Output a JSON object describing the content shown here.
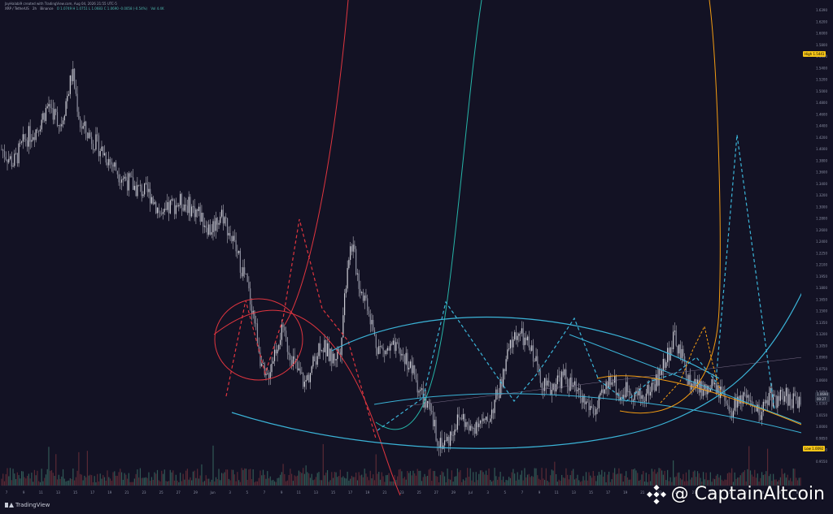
{
  "header": {
    "author": "JayHalabi9 created with TradingView.com, Aug 04, 2026 21:55 UTC-5",
    "symbol": "XRP / TetherUS",
    "interval": "2h",
    "exchange": "Binance",
    "ohlc": "O 1.0749  H 1.0751  L 1.0683  C 1.0690  -0.0058 (-0.54%)",
    "volume": "Vol 4.4K"
  },
  "badges": {
    "high_label": "High",
    "high_value": "1.5441",
    "low_label": "Low",
    "low_value": "1.0092",
    "price_value": "1.0690",
    "price_time": "00:27"
  },
  "branding": {
    "tradingview": "TradingView",
    "watermark": "@ CaptainAltcoin"
  },
  "colors": {
    "background": "#131224",
    "candle": "#d0d0d8",
    "volume_up": "#3a6b63",
    "volume_down": "#6b2f3a",
    "red_curve": "#e0353f",
    "teal_curve": "#26b5a8",
    "orange_curve": "#f39c12",
    "cyan_line": "#3bb4d8",
    "axis_text": "#8a8fa3"
  },
  "chart_data": {
    "type": "candlestick",
    "title": "",
    "xlabel": "",
    "ylabel": "",
    "ylim": [
      0.955,
      1.639
    ],
    "x_ticks": [
      "7",
      "9",
      "11",
      "13",
      "15",
      "17",
      "19",
      "21",
      "23",
      "25",
      "27",
      "29",
      "Jun",
      "3",
      "5",
      "7",
      "9",
      "11",
      "13",
      "15",
      "17",
      "19",
      "21",
      "23",
      "25",
      "27",
      "29",
      "Jul",
      "3",
      "5",
      "7",
      "9",
      "11",
      "13",
      "15",
      "17",
      "19",
      "21",
      "23",
      "25",
      "27",
      "29",
      "31",
      "2",
      "4",
      "6",
      "8"
    ],
    "y_ticks": [
      "1.6390",
      "1.6200",
      "1.6000",
      "1.5800",
      "1.5600",
      "1.5400",
      "1.5200",
      "1.5000",
      "1.4800",
      "1.4600",
      "1.4400",
      "1.4200",
      "1.4000",
      "1.3800",
      "1.3600",
      "1.3400",
      "1.3200",
      "1.3000",
      "1.2800",
      "1.2600",
      "1.2400",
      "1.2250",
      "1.2100",
      "1.1950",
      "1.1800",
      "1.1650",
      "1.1500",
      "1.1350",
      "1.1200",
      "1.1050",
      "1.0900",
      "1.0750",
      "1.0600",
      "1.0450",
      "1.0300",
      "1.0150",
      "1.0000",
      "0.9850",
      "0.9700",
      "0.9550"
    ],
    "price_path": [
      [
        0,
        1.435
      ],
      [
        3,
        1.415
      ],
      [
        6,
        1.45
      ],
      [
        9,
        1.465
      ],
      [
        12,
        1.5
      ],
      [
        15,
        1.47
      ],
      [
        18,
        1.545
      ],
      [
        20,
        1.47
      ],
      [
        23,
        1.45
      ],
      [
        26,
        1.43
      ],
      [
        30,
        1.4
      ],
      [
        34,
        1.38
      ],
      [
        38,
        1.37
      ],
      [
        41,
        1.335
      ],
      [
        43,
        1.355
      ],
      [
        46,
        1.36
      ],
      [
        50,
        1.345
      ],
      [
        53,
        1.32
      ],
      [
        56,
        1.345
      ],
      [
        59,
        1.3
      ],
      [
        62,
        1.25
      ],
      [
        64,
        1.2
      ],
      [
        66,
        1.13
      ],
      [
        67,
        1.1
      ],
      [
        69,
        1.14
      ],
      [
        71,
        1.175
      ],
      [
        73,
        1.15
      ],
      [
        75,
        1.12
      ],
      [
        77,
        1.1
      ],
      [
        79,
        1.125
      ],
      [
        81,
        1.16
      ],
      [
        84,
        1.135
      ],
      [
        86,
        1.15
      ],
      [
        88,
        1.28
      ],
      [
        89,
        1.3
      ],
      [
        91,
        1.24
      ],
      [
        93,
        1.215
      ],
      [
        95,
        1.16
      ],
      [
        97,
        1.145
      ],
      [
        99,
        1.15
      ],
      [
        101,
        1.145
      ],
      [
        103,
        1.135
      ],
      [
        105,
        1.11
      ],
      [
        107,
        1.08
      ],
      [
        109,
        1.055
      ],
      [
        111,
        1.02
      ],
      [
        113,
        1.015
      ],
      [
        115,
        1.04
      ],
      [
        117,
        1.055
      ],
      [
        119,
        1.03
      ],
      [
        121,
        1.05
      ],
      [
        123,
        1.04
      ],
      [
        125,
        1.07
      ],
      [
        127,
        1.1
      ],
      [
        129,
        1.15
      ],
      [
        131,
        1.175
      ],
      [
        133,
        1.16
      ],
      [
        135,
        1.145
      ],
      [
        137,
        1.11
      ],
      [
        139,
        1.09
      ],
      [
        141,
        1.105
      ],
      [
        143,
        1.11
      ],
      [
        145,
        1.095
      ],
      [
        147,
        1.08
      ],
      [
        149,
        1.07
      ],
      [
        151,
        1.06
      ],
      [
        153,
        1.085
      ],
      [
        155,
        1.115
      ],
      [
        157,
        1.08
      ],
      [
        159,
        1.095
      ],
      [
        161,
        1.085
      ],
      [
        163,
        1.08
      ],
      [
        165,
        1.095
      ],
      [
        167,
        1.11
      ],
      [
        169,
        1.14
      ],
      [
        171,
        1.165
      ],
      [
        173,
        1.135
      ],
      [
        175,
        1.1
      ],
      [
        177,
        1.095
      ],
      [
        179,
        1.09
      ],
      [
        181,
        1.095
      ],
      [
        183,
        1.085
      ],
      [
        185,
        1.05
      ],
      [
        187,
        1.08
      ],
      [
        189,
        1.075
      ],
      [
        191,
        1.06
      ],
      [
        193,
        1.06
      ],
      [
        195,
        1.085
      ],
      [
        197,
        1.075
      ],
      [
        199,
        1.085
      ],
      [
        201,
        1.075
      ],
      [
        203,
        1.08
      ]
    ],
    "x_span": 203
  }
}
